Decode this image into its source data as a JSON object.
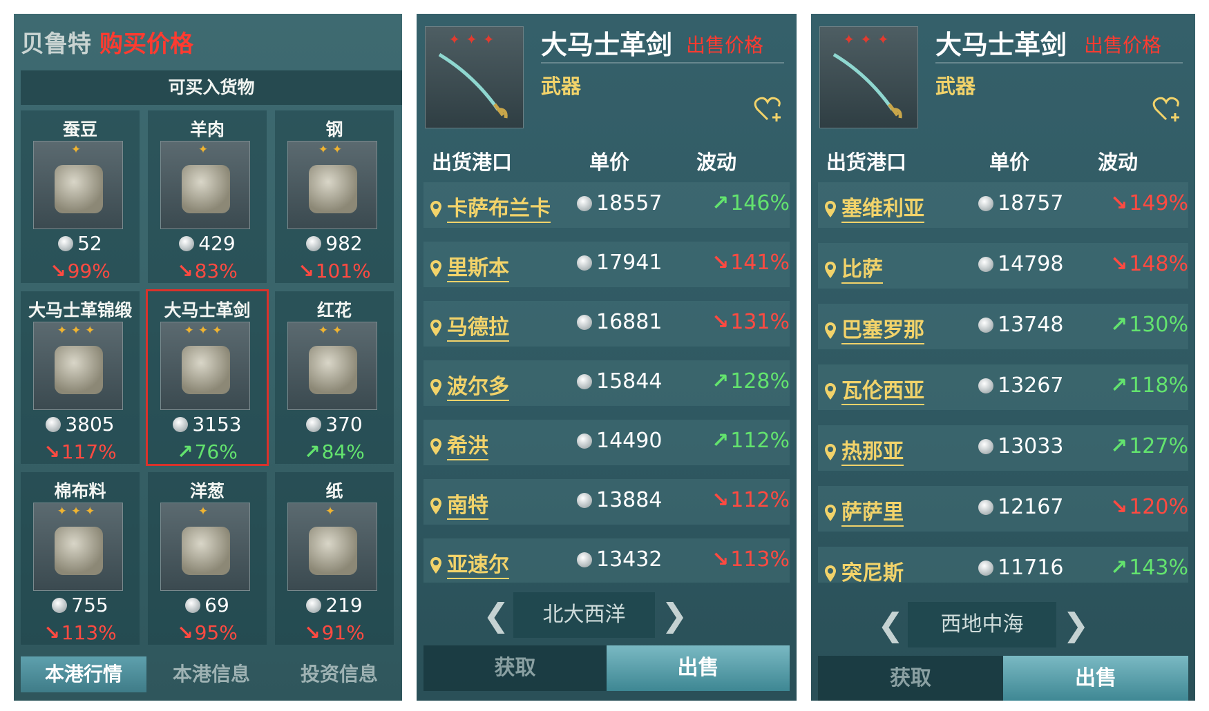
{
  "panel1": {
    "city": "贝鲁特",
    "title": "购买价格",
    "section": "可买入货物",
    "goods": [
      {
        "name": "蚕豆",
        "stars": "✦",
        "price": "52",
        "change": "99%",
        "dir": "down",
        "icon": "broad-beans-icon"
      },
      {
        "name": "羊肉",
        "stars": "✦",
        "price": "429",
        "change": "83%",
        "dir": "down",
        "icon": "mutton-icon"
      },
      {
        "name": "钢",
        "stars": "✦✦",
        "price": "982",
        "change": "101%",
        "dir": "down",
        "icon": "steel-icon"
      },
      {
        "name": "大马士革锦缎",
        "stars": "✦✦✦",
        "price": "3805",
        "change": "117%",
        "dir": "down",
        "icon": "damask-cloth-icon"
      },
      {
        "name": "大马士革剑",
        "stars": "✦✦✦",
        "price": "3153",
        "change": "76%",
        "dir": "up",
        "icon": "damascus-sword-icon"
      },
      {
        "name": "红花",
        "stars": "✦✦",
        "price": "370",
        "change": "84%",
        "dir": "up",
        "icon": "safflower-icon"
      },
      {
        "name": "棉布料",
        "stars": "✦✦✦",
        "price": "755",
        "change": "113%",
        "dir": "down",
        "icon": "cotton-cloth-icon"
      },
      {
        "name": "洋葱",
        "stars": "✦",
        "price": "69",
        "change": "95%",
        "dir": "down",
        "icon": "onion-icon"
      },
      {
        "name": "纸",
        "stars": "✦",
        "price": "219",
        "change": "91%",
        "dir": "down",
        "icon": "paper-icon"
      }
    ],
    "tabs": [
      "本港行情",
      "本港信息",
      "投资信息"
    ]
  },
  "panel2": {
    "item": "大马士革剑",
    "sell_label": "出售价格",
    "stars": "✦✦✦",
    "category": "武器",
    "headers": {
      "port": "出货港口",
      "price": "单价",
      "change": "波动"
    },
    "rows": [
      {
        "port": "卡萨布兰卡",
        "price": "18557",
        "change": "146%",
        "dir": "up"
      },
      {
        "port": "里斯本",
        "price": "17941",
        "change": "141%",
        "dir": "down"
      },
      {
        "port": "马德拉",
        "price": "16881",
        "change": "131%",
        "dir": "down"
      },
      {
        "port": "波尔多",
        "price": "15844",
        "change": "128%",
        "dir": "up"
      },
      {
        "port": "希洪",
        "price": "14490",
        "change": "112%",
        "dir": "up"
      },
      {
        "port": "南特",
        "price": "13884",
        "change": "112%",
        "dir": "down"
      },
      {
        "port": "亚速尔",
        "price": "13432",
        "change": "113%",
        "dir": "down"
      }
    ],
    "region": "北大西洋",
    "btn_get": "获取",
    "btn_sell": "出售"
  },
  "panel3": {
    "item": "大马士革剑",
    "sell_label": "出售价格",
    "stars": "✦✦✦",
    "category": "武器",
    "headers": {
      "port": "出货港口",
      "price": "单价",
      "change": "波动"
    },
    "rows": [
      {
        "port": "塞维利亚",
        "price": "18757",
        "change": "149%",
        "dir": "down"
      },
      {
        "port": "比萨",
        "price": "14798",
        "change": "148%",
        "dir": "down"
      },
      {
        "port": "巴塞罗那",
        "price": "13748",
        "change": "130%",
        "dir": "up"
      },
      {
        "port": "瓦伦西亚",
        "price": "13267",
        "change": "118%",
        "dir": "up"
      },
      {
        "port": "热那亚",
        "price": "13033",
        "change": "127%",
        "dir": "up"
      },
      {
        "port": "萨萨里",
        "price": "12167",
        "change": "120%",
        "dir": "down"
      },
      {
        "port": "突尼斯",
        "price": "11716",
        "change": "143%",
        "dir": "up"
      }
    ],
    "region": "西地中海",
    "btn_get": "获取",
    "btn_sell": "出售"
  },
  "colors": {
    "up": "#63e36e",
    "down": "#ff4a41",
    "port": "#f2d36a",
    "title_red": "#ff3b30",
    "star_gold": "#f0b431",
    "star_red": "#e23b2f"
  }
}
